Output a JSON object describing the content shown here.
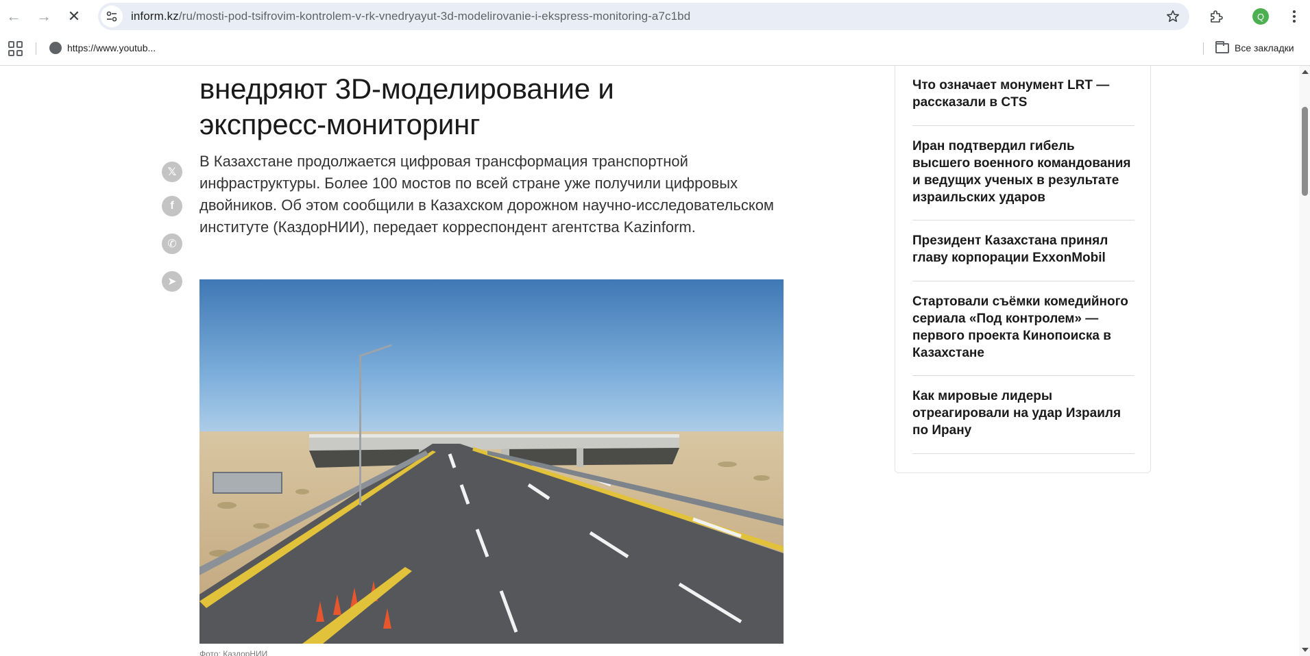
{
  "browser": {
    "url_host": "inform.kz",
    "url_path": "/ru/mosti-pod-tsifrovim-kontrolem-v-rk-vnedryayut-3d-modelirovanie-i-ekspress-monitoring-a7c1bd",
    "profile_initial": "Q",
    "bookmarks": [
      {
        "label": "https://www.youtub..."
      }
    ],
    "all_bookmarks_label": "Все закладки"
  },
  "article": {
    "headline_lines": [
      "внедряют 3D-моделирование и",
      "экспресс-мониторинг"
    ],
    "lead": "В Казахстане продолжается цифровая трансформация транспортной инфраструктуры. Более 100 мостов по всей стране уже получили цифровых двойников. Об этом сообщили в Казахском дорожном научно-исследовательском институте (КаздорНИИ), передает корреспондент агентства Kazinform.",
    "caption": "Фото: КаздорНИИ"
  },
  "share": [
    {
      "name": "x-share-icon",
      "glyph": "𝕏"
    },
    {
      "name": "facebook-share-icon",
      "glyph": "f"
    },
    {
      "name": "whatsapp-share-icon",
      "glyph": "✆"
    },
    {
      "name": "telegram-share-icon",
      "glyph": "➤"
    }
  ],
  "sidebar": {
    "news": [
      "Что означает монумент LRT — рассказали в CTS",
      "Иран подтвердил гибель высшего военного командования и ведущих ученых в результате израильских ударов",
      "Президент Казахстана принял главу корпорации ExxonMobil",
      "Стартовали съёмки комедийного сериала «Под контролем» — первого проекта Кинопоиска в Казахстане",
      "Как мировые лидеры отреагировали на удар Израиля по Ирану"
    ]
  }
}
